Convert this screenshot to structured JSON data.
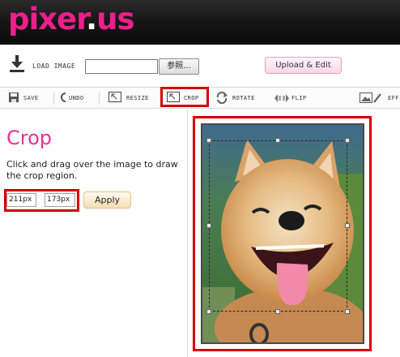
{
  "app": {
    "logo_main": "pixer",
    "logo_dot": ".",
    "logo_tld": "us"
  },
  "load": {
    "label": "LOAD IMAGE",
    "file_value": "",
    "browse_label": "参照...",
    "upload_label": "Upload & Edit"
  },
  "toolbar": {
    "save": "SAVE",
    "undo": "UNDO",
    "resize": "RESIZE",
    "crop": "CROP",
    "rotate": "ROTATE",
    "flip": "FLIP",
    "effects": "EFF"
  },
  "crop_panel": {
    "title": "Crop",
    "instruction": "Click and drag over the image to draw the crop region.",
    "width_value": "211px",
    "height_value": "173px",
    "apply_label": "Apply"
  },
  "colors": {
    "brand_pink": "#ee1f8c",
    "title_pink": "#e3348e",
    "highlight_red": "#d40000"
  },
  "icons": [
    "download-icon",
    "save-icon",
    "undo-icon",
    "resize-icon",
    "crop-icon",
    "rotate-icon",
    "flip-icon",
    "effects-icon"
  ]
}
